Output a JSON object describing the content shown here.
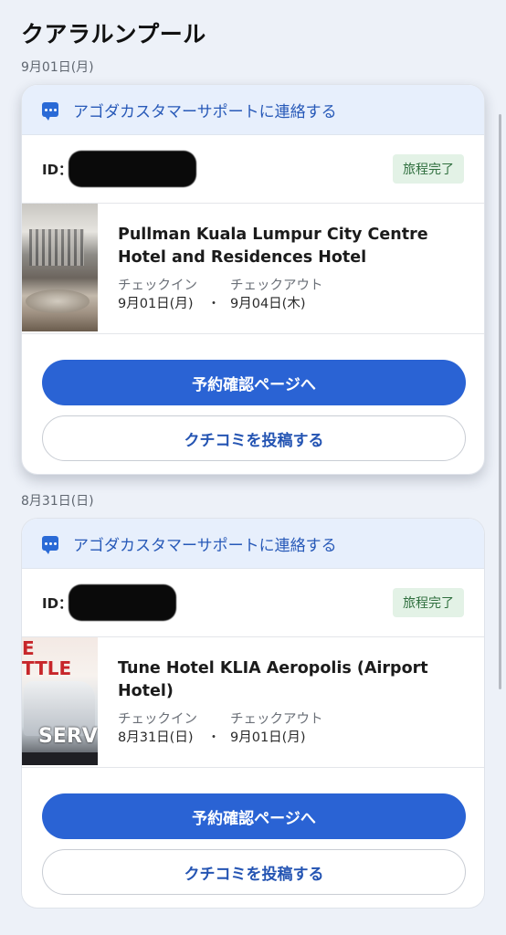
{
  "page": {
    "title": "クアラルンプール"
  },
  "bookings": [
    {
      "date_label": "9月01日(月)",
      "support_text": "アゴダカスタマーサポートに連絡する",
      "id_label": "ID：",
      "status": "旅程完了",
      "hotel_name": "Pullman Kuala Lumpur City Centre Hotel and Residences Hotel",
      "checkin_label": "チェックイン",
      "checkin_date": "9月01日(月)",
      "separator": "・",
      "checkout_label": "チェックアウト",
      "checkout_date": "9月04日(木)",
      "primary_button": "予約確認ページへ",
      "secondary_button": "クチコミを投稿する"
    },
    {
      "date_label": "8月31日(日)",
      "support_text": "アゴダカスタマーサポートに連絡する",
      "id_label": "ID：",
      "status": "旅程完了",
      "hotel_name": "Tune Hotel KLIA Aeropolis (Airport Hotel)",
      "checkin_label": "チェックイン",
      "checkin_date": "8月31日(日)",
      "separator": "・",
      "checkout_label": "チェックアウト",
      "checkout_date": "9月01日(月)",
      "primary_button": "予約確認ページへ",
      "secondary_button": "クチコミを投稿する"
    }
  ],
  "colors": {
    "accent": "#2a63d4",
    "status_bg": "#e3f2e6",
    "support_bg": "#e7effc"
  },
  "icons": {
    "support": "chat-bubble-icon"
  }
}
